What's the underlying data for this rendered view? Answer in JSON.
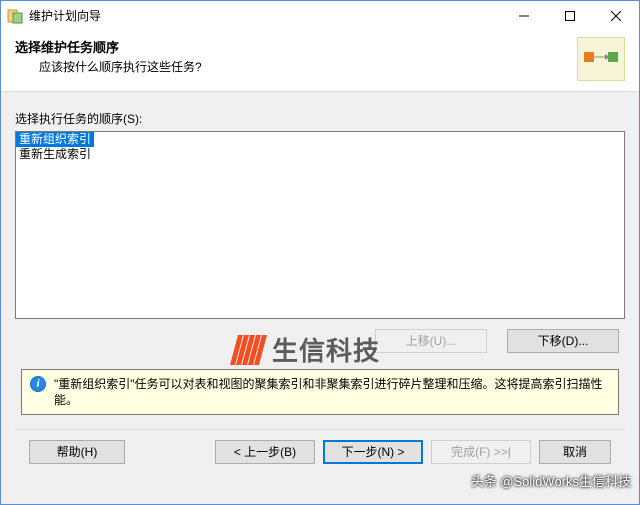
{
  "titlebar": {
    "title": "维护计划向导"
  },
  "header": {
    "title": "选择维护任务顺序",
    "subtitle": "应该按什么顺序执行这些任务?"
  },
  "list": {
    "label": "选择执行任务的顺序(S):",
    "items": [
      "重新组织索引",
      "重新生成索引"
    ],
    "selected_index": 0
  },
  "buttons": {
    "move_up": "上移(U)...",
    "move_down": "下移(D)...",
    "help": "帮助(H)",
    "back": "< 上一步(B)",
    "next": "下一步(N) >",
    "finish": "完成(F) >>|",
    "cancel": "取消"
  },
  "info": {
    "text": "\"重新组织索引\"任务可以对表和视图的聚集索引和非聚集索引进行碎片整理和压缩。这将提高索引扫描性能。"
  },
  "watermark": {
    "text": "生信科技"
  },
  "attribution": "头条 @SolidWorks生信科技"
}
